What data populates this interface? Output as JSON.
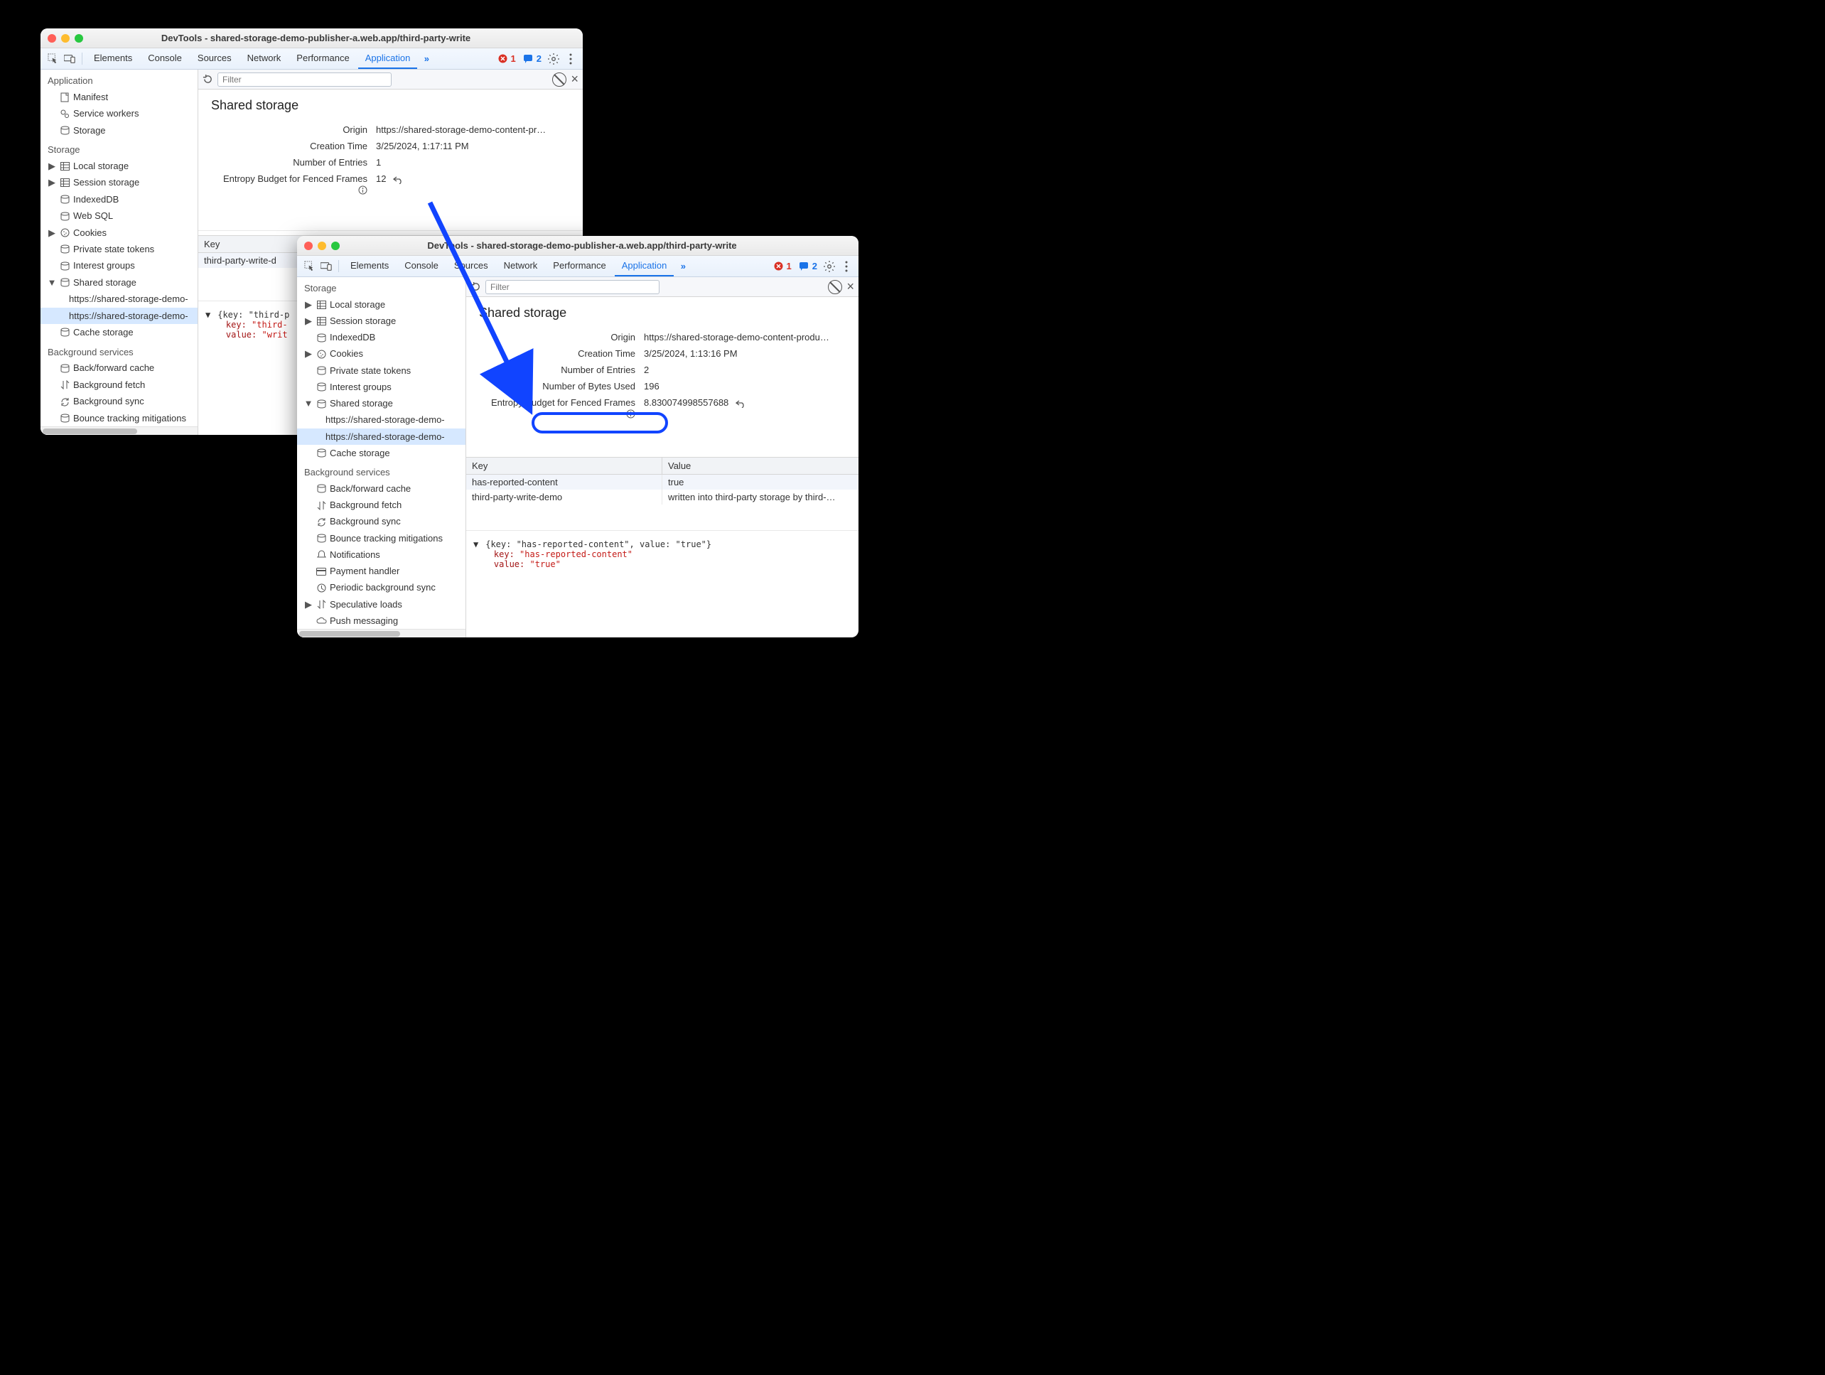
{
  "window1": {
    "title": "DevTools - shared-storage-demo-publisher-a.web.app/third-party-write",
    "tabs": [
      "Elements",
      "Console",
      "Sources",
      "Network",
      "Performance",
      "Application"
    ],
    "err_count": "1",
    "msg_count": "2",
    "filter_placeholder": "Filter",
    "heading": "Shared storage",
    "origin_label": "Origin",
    "origin_value": "https://shared-storage-demo-content-pr…",
    "creation_label": "Creation Time",
    "creation_value": "3/25/2024, 1:17:11 PM",
    "entries_label": "Number of Entries",
    "entries_value": "1",
    "entropy_label": "Entropy Budget for Fenced Frames",
    "entropy_value": "12",
    "key_header": "Key",
    "key_row1": "third-party-write-d",
    "json_head": "{key: \"third-p",
    "json_keylabel": "key:",
    "json_keyval": "\"third-",
    "json_vallabel": "value:",
    "json_valval": "\"writ",
    "sidebar": {
      "app_title": "Application",
      "app_manifest": "Manifest",
      "app_service": "Service workers",
      "app_storage": "Storage",
      "storage_title": "Storage",
      "local": "Local storage",
      "session": "Session storage",
      "indexed": "IndexedDB",
      "websql": "Web SQL",
      "cookies": "Cookies",
      "pst": "Private state tokens",
      "ig": "Interest groups",
      "shared": "Shared storage",
      "shared_a": "https://shared-storage-demo-",
      "shared_b": "https://shared-storage-demo-",
      "cache": "Cache storage",
      "bg_title": "Background services",
      "bfc": "Back/forward cache",
      "bgfetch": "Background fetch",
      "bgsync": "Background sync",
      "btm": "Bounce tracking mitigations"
    }
  },
  "window2": {
    "title": "DevTools - shared-storage-demo-publisher-a.web.app/third-party-write",
    "tabs": [
      "Elements",
      "Console",
      "Sources",
      "Network",
      "Performance",
      "Application"
    ],
    "err_count": "1",
    "msg_count": "2",
    "filter_placeholder": "Filter",
    "heading": "Shared storage",
    "origin_label": "Origin",
    "origin_value": "https://shared-storage-demo-content-produ…",
    "creation_label": "Creation Time",
    "creation_value": "3/25/2024, 1:13:16 PM",
    "entries_label": "Number of Entries",
    "entries_value": "2",
    "bytes_label": "Number of Bytes Used",
    "bytes_value": "196",
    "entropy_label": "Entropy Budget for Fenced Frames",
    "entropy_value": "8.830074998557688",
    "table": {
      "key_header": "Key",
      "val_header": "Value",
      "rows": [
        {
          "k": "has-reported-content",
          "v": "true"
        },
        {
          "k": "third-party-write-demo",
          "v": "written into third-party storage by third-…"
        }
      ]
    },
    "json_head": "{key: \"has-reported-content\", value: \"true\"}",
    "json_keylabel": "key:",
    "json_keyval": "\"has-reported-content\"",
    "json_vallabel": "value:",
    "json_valval": "\"true\"",
    "sidebar": {
      "storage_title": "Storage",
      "local": "Local storage",
      "session": "Session storage",
      "indexed": "IndexedDB",
      "cookies": "Cookies",
      "pst": "Private state tokens",
      "ig": "Interest groups",
      "shared": "Shared storage",
      "shared_a": "https://shared-storage-demo-",
      "shared_b": "https://shared-storage-demo-",
      "cache": "Cache storage",
      "bg_title": "Background services",
      "bfc": "Back/forward cache",
      "bgfetch": "Background fetch",
      "bgsync": "Background sync",
      "btm": "Bounce tracking mitigations",
      "notif": "Notifications",
      "pay": "Payment handler",
      "pbs": "Periodic background sync",
      "spec": "Speculative loads",
      "push": "Push messaging"
    }
  }
}
